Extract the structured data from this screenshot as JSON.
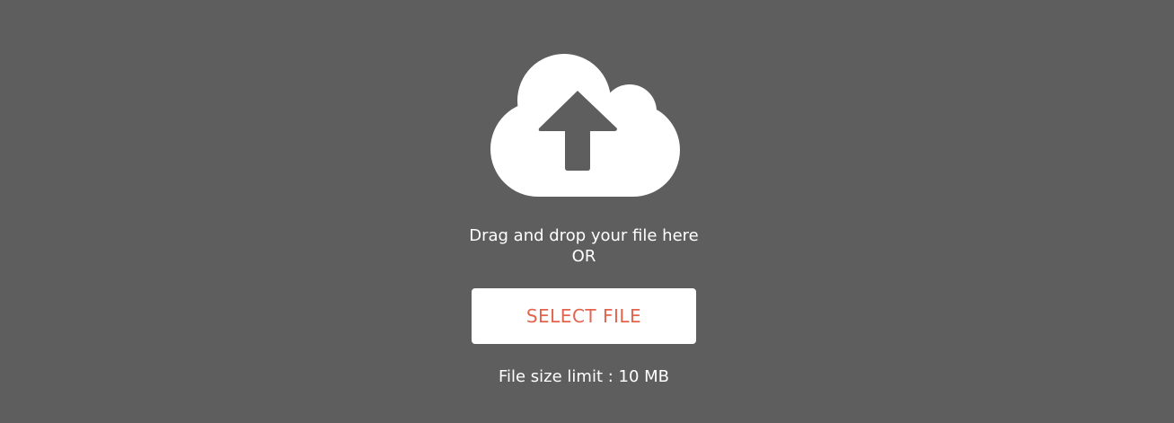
{
  "upload": {
    "icon": "cloud-upload-icon",
    "drag_text": "Drag and drop your file here",
    "or_text": "OR",
    "select_label": "SELECT FILE",
    "limit_text": "File size limit : 10 MB"
  },
  "colors": {
    "background": "#5e5e5e",
    "icon": "#ffffff",
    "button_bg": "#ffffff",
    "button_text": "#e4634f",
    "text": "#ffffff"
  }
}
